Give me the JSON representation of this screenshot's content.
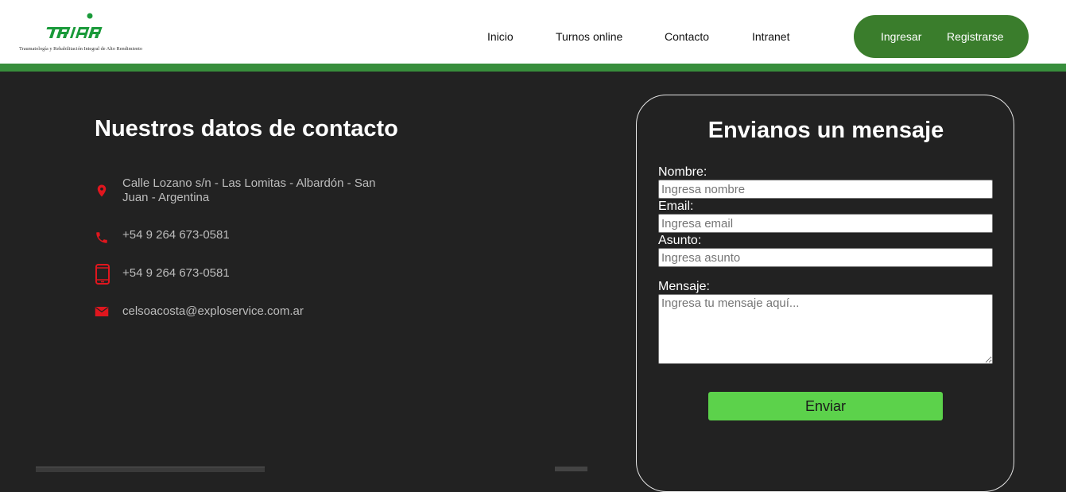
{
  "brand": {
    "logo_text": "TRIAR",
    "tagline": "Traumatología y Rehabilitación Integral de Alto Rendimiento"
  },
  "nav": {
    "items": [
      "Inicio",
      "Turnos online",
      "Contacto",
      "Intranet"
    ]
  },
  "auth": {
    "login_label": "Ingresar",
    "register_label": "Registrarse"
  },
  "contact": {
    "title": "Nuestros datos de contacto",
    "address": "Calle Lozano s/n - Las Lomitas - Albardón - San Juan - Argentina",
    "phone": "+54 9 264 673-0581",
    "mobile": "+54 9 264 673-0581",
    "email": "celsoacosta@exploservice.com.ar"
  },
  "form": {
    "title": "Envianos un mensaje",
    "name_label": "Nombre:",
    "name_placeholder": "Ingresa nombre",
    "email_label": "Email:",
    "email_placeholder": "Ingresa email",
    "subject_label": "Asunto:",
    "subject_placeholder": "Ingresa asunto",
    "message_label": "Mensaje:",
    "message_placeholder": "Ingresa tu mensaje aquí...",
    "submit_label": "Enviar"
  },
  "colors": {
    "brand_green": "#388e3c",
    "pill_green": "#3a7d2c",
    "button_green": "#5cd24b",
    "icon_red": "#e0161e",
    "background": "#222222"
  }
}
